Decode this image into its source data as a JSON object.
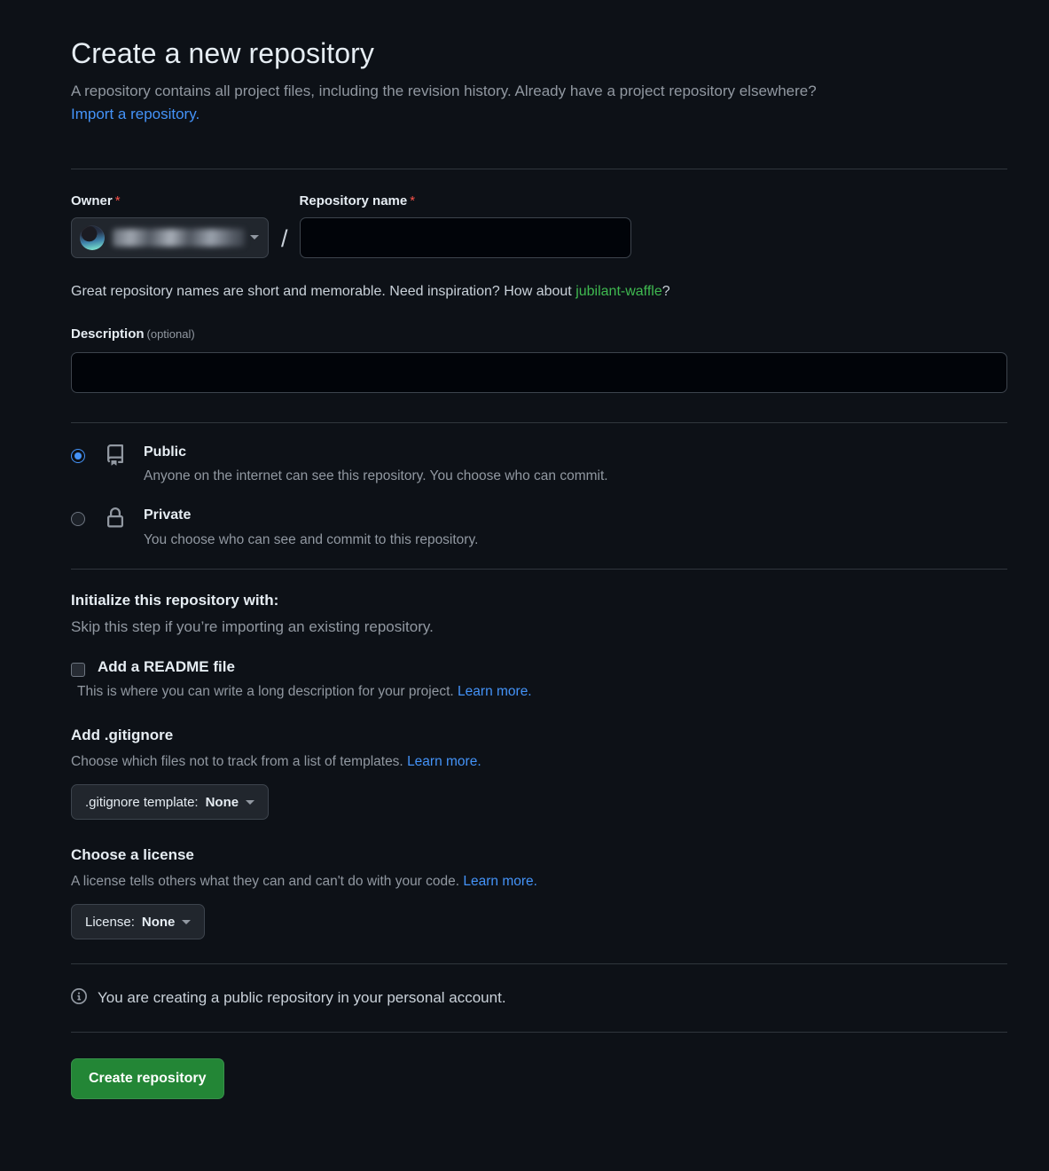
{
  "header": {
    "title": "Create a new repository",
    "subtitle_part1": "A repository contains all project files, including the revision history. Already have a project repository elsewhere?",
    "import_link": "Import a repository."
  },
  "owner": {
    "label": "Owner",
    "required_marker": "*",
    "value": "",
    "avatar_icon": "user-avatar-icon",
    "caret_icon": "chevron-down-icon"
  },
  "separator": "/",
  "repo_name": {
    "label": "Repository name",
    "required_marker": "*",
    "value": "",
    "placeholder": ""
  },
  "name_hint": {
    "prefix": "Great repository names are short and memorable. Need inspiration? How about ",
    "suggestion": "jubilant-waffle",
    "suffix": "?"
  },
  "description": {
    "label": "Description",
    "optional": "(optional)",
    "value": "",
    "placeholder": ""
  },
  "visibility": {
    "public": {
      "title": "Public",
      "description": "Anyone on the internet can see this repository. You choose who can commit.",
      "icon": "repo-book-icon",
      "selected": true
    },
    "private": {
      "title": "Private",
      "description": "You choose who can see and commit to this repository.",
      "icon": "lock-icon",
      "selected": false
    }
  },
  "initialize": {
    "heading": "Initialize this repository with:",
    "subheading": "Skip this step if you’re importing an existing repository.",
    "readme": {
      "label": "Add a README file",
      "description": "This is where you can write a long description for your project.",
      "learn_more": "Learn more.",
      "checked": false
    }
  },
  "gitignore": {
    "heading": "Add .gitignore",
    "description": "Choose which files not to track from a list of templates.",
    "learn_more": "Learn more.",
    "button_prefix": ".gitignore template:",
    "button_value": "None",
    "caret_icon": "chevron-down-icon"
  },
  "license": {
    "heading": "Choose a license",
    "description": "A license tells others what they can and can't do with your code.",
    "learn_more": "Learn more.",
    "button_prefix": "License:",
    "button_value": "None",
    "caret_icon": "chevron-down-icon"
  },
  "footer": {
    "info_icon": "info-circle-icon",
    "info_text": "You are creating a public repository in your personal account.",
    "create_button": "Create repository"
  },
  "colors": {
    "page_background": "#0d1117",
    "input_background": "#010409",
    "border": "#30363d",
    "link": "#4493f8",
    "required": "#f85149",
    "suggestion_green": "#3fb950",
    "primary_button": "#238636",
    "muted_text": "#9198a1"
  }
}
